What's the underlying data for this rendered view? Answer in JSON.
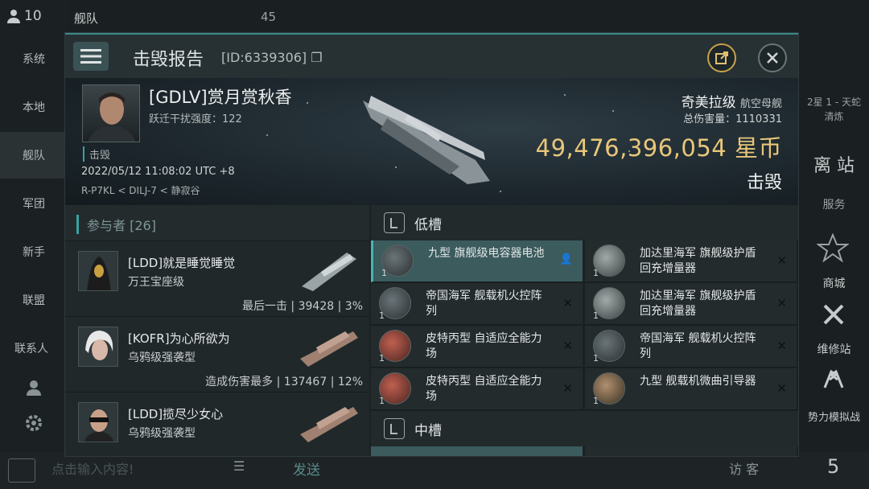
{
  "background": {
    "pilot_count": "10",
    "tab_title": "舰队",
    "slot_count": "45",
    "nav": [
      "系统",
      "本地",
      "舰队",
      "军团",
      "新手",
      "联盟",
      "联系人"
    ],
    "right_partial_station": "2星 1 - 天蛇",
    "right_partial_station2": "清炼",
    "right_undock": "离 站",
    "right_service": "服务",
    "right_shop": "商城",
    "right_repair": "维修站",
    "right_sim": "势力模拟战",
    "chat_placeholder": "点击输入内容!",
    "send_label": "发送",
    "visitor_label": "访 客",
    "corner_number": "5"
  },
  "dialog": {
    "title": "击毁报告",
    "report_id": "[ID:6339306]",
    "victim": {
      "name": "[GDLV]赏月赏秋香",
      "warp_disrupt": "跃迁干扰强度：122",
      "status": "击毁",
      "datetime": "2022/05/12 11:08:02 UTC +8",
      "location": "R-P7KL < DILJ-7 < 静寂谷"
    },
    "ship": {
      "class_name": "奇美拉级",
      "class_type": "航空母舰",
      "total_damage": "总伤害量：1110331",
      "isk_value": "49,476,396,054",
      "isk_unit": "星币",
      "result": "击毁"
    },
    "participants": {
      "title": "参与者 [26]",
      "rows": [
        {
          "name": "[LDD]就是睡觉睡觉",
          "ship": "万王宝座级",
          "note": "最后一击",
          "damage": "39428",
          "percent": "3%"
        },
        {
          "name": "[KOFR]为心所欲为",
          "ship": "乌鸦级强袭型",
          "note": "造成伤害最多",
          "damage": "137467",
          "percent": "12%"
        },
        {
          "name": "[LDD]揽尽少女心",
          "ship": "乌鸦级强袭型",
          "note": "",
          "damage": "",
          "percent": ""
        }
      ]
    },
    "low_slots": {
      "title": "低槽",
      "left": [
        {
          "name": "九型 旗舰级电容器电池",
          "qty": "1",
          "status": "person-icon"
        },
        {
          "name": "帝国海军 舰载机火控阵列",
          "qty": "1",
          "status": "x"
        },
        {
          "name": "皮特丙型 自适应全能力场",
          "qty": "1",
          "status": "x"
        },
        {
          "name": "皮特丙型 自适应全能力场",
          "qty": "1",
          "status": "x"
        }
      ],
      "right": [
        {
          "name": "加达里海军 旗舰级护盾回充增量器",
          "qty": "1",
          "status": "x"
        },
        {
          "name": "加达里海军 旗舰级护盾回充增量器",
          "qty": "1",
          "status": "x"
        },
        {
          "name": "帝国海军 舰载机火控阵列",
          "qty": "1",
          "status": "x"
        },
        {
          "name": "九型 舰载机微曲引导器",
          "qty": "1",
          "status": "x"
        }
      ]
    },
    "mid_slots": {
      "title": "中槽"
    }
  },
  "colors": {
    "accent": "#3aa0a0",
    "isk": "#e8c77a",
    "active_item": "#3b5b5d"
  }
}
